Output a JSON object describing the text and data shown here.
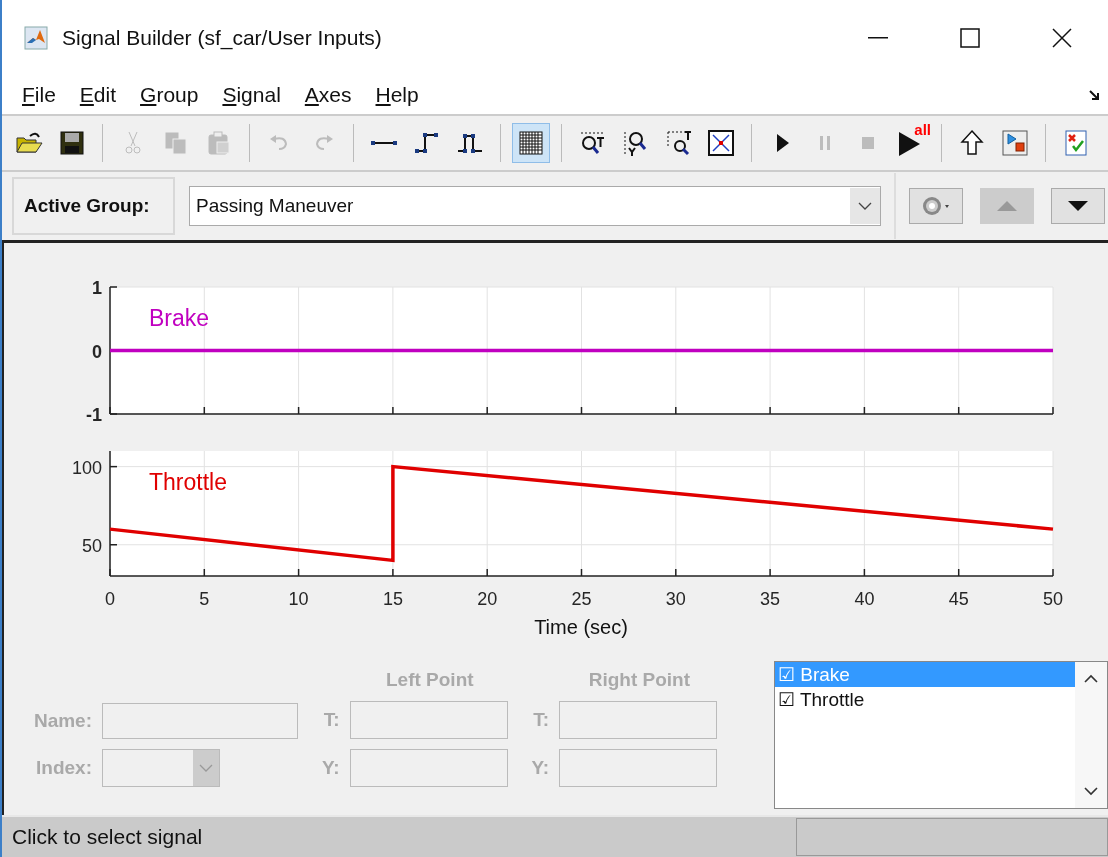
{
  "window": {
    "title": "Signal Builder (sf_car/User Inputs)"
  },
  "menu": [
    {
      "label": "File"
    },
    {
      "label": "Edit"
    },
    {
      "label": "Group"
    },
    {
      "label": "Signal"
    },
    {
      "label": "Axes"
    },
    {
      "label": "Help"
    }
  ],
  "toolbar": {
    "groups": [
      [
        {
          "kind": "open",
          "disabled": false
        },
        {
          "kind": "save",
          "disabled": false
        }
      ],
      [
        {
          "kind": "cut",
          "disabled": true
        },
        {
          "kind": "copy",
          "disabled": true
        },
        {
          "kind": "paste",
          "disabled": true
        }
      ],
      [
        {
          "kind": "undo",
          "disabled": true
        },
        {
          "kind": "redo",
          "disabled": true
        }
      ],
      [
        {
          "kind": "line",
          "disabled": false
        },
        {
          "kind": "step",
          "disabled": false
        },
        {
          "kind": "pulse",
          "disabled": false
        }
      ],
      [
        {
          "kind": "grid",
          "disabled": false,
          "selected": true
        }
      ],
      [
        {
          "kind": "zoom-x",
          "disabled": false
        },
        {
          "kind": "zoom-y",
          "disabled": false
        },
        {
          "kind": "zoom-xy",
          "disabled": false
        },
        {
          "kind": "fit",
          "disabled": false
        }
      ],
      [
        {
          "kind": "play",
          "disabled": false
        },
        {
          "kind": "pause",
          "disabled": true
        },
        {
          "kind": "stop",
          "disabled": true
        },
        {
          "kind": "play-all",
          "disabled": false,
          "badge": "all"
        }
      ],
      [
        {
          "kind": "up",
          "disabled": false
        },
        {
          "kind": "model",
          "disabled": false
        }
      ],
      [
        {
          "kind": "verify",
          "disabled": false
        }
      ]
    ]
  },
  "active_group": {
    "label": "Active Group:",
    "value": "Passing Maneuver",
    "buttons": [
      {
        "kind": "settings",
        "disabled": false
      },
      {
        "kind": "move-up",
        "disabled": true
      },
      {
        "kind": "move-down",
        "disabled": false
      }
    ]
  },
  "charts": [
    {
      "chart_data": {
        "type": "line",
        "x": [
          0,
          50
        ],
        "series": [
          {
            "name": "Brake",
            "color": "#c000c0",
            "values": [
              0,
              0
            ]
          }
        ],
        "xlim": [
          0,
          50
        ],
        "ylim": [
          -1,
          1
        ],
        "yticks": [
          {
            "value": -1,
            "label": "-1"
          },
          {
            "value": 0,
            "label": "0"
          },
          {
            "value": 1,
            "label": "1"
          }
        ],
        "grid": true
      }
    },
    {
      "chart_data": {
        "type": "line",
        "xlabel": "Time (sec)",
        "x": [
          0,
          15,
          15,
          50
        ],
        "series": [
          {
            "name": "Throttle",
            "color": "#e00000",
            "values": [
              60,
              40,
              100,
              60
            ]
          }
        ],
        "xlim": [
          0,
          50
        ],
        "ylim": [
          30,
          110
        ],
        "yticks": [
          50,
          100
        ],
        "grid": true,
        "xticks": [
          0,
          5,
          10,
          15,
          20,
          25,
          30,
          35,
          40,
          45,
          50
        ]
      }
    }
  ],
  "signal_editor": {
    "name_label": "Name:",
    "index_label": "Index:",
    "left_point": {
      "title": "Left Point",
      "t_label": "T:",
      "y_label": "Y:"
    },
    "right_point": {
      "title": "Right Point",
      "t_label": "T:",
      "y_label": "Y:"
    },
    "disabled": true
  },
  "signals": [
    {
      "mark": "☑",
      "label": "Brake",
      "selected": true
    },
    {
      "mark": "☑",
      "label": "Throttle",
      "selected": false
    }
  ],
  "status_bar": {
    "text": "Click to select signal"
  }
}
